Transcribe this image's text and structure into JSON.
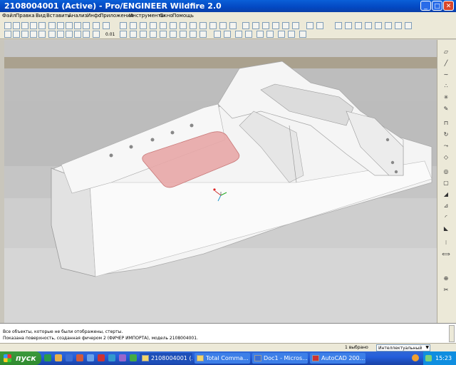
{
  "window": {
    "title": "2108004001 (Active) - Pro/ENGINEER Wildfire 2.0"
  },
  "menu": [
    "Файл",
    "Правка",
    "Вид",
    "Вставить",
    "Анализ",
    "Инфо",
    "Приложения",
    "Инструменты",
    "Окно",
    "Помощь"
  ],
  "toolbar": {
    "precision_label": "0.01"
  },
  "messages": [
    "Все объекты, которые не были отображены, стерты.",
    "Показана поверхность, созданная фичером 2 (ФИЧЕР ИМПОРТА), модель 2108004001."
  ],
  "status": {
    "selected": "1 выбрано",
    "filter": "Интеллектуальный"
  },
  "taskbar": {
    "start": "пуск",
    "buttons": [
      "2108004001 (...",
      "Total Comma...",
      "Doc1 - Micros...",
      "AutoCAD 200..."
    ],
    "clock": "15:23"
  },
  "colors": {
    "title_blue": "#0a5fd8",
    "part_pink": "#e8a8a8",
    "viewport_gray": "#bdbdbd"
  }
}
